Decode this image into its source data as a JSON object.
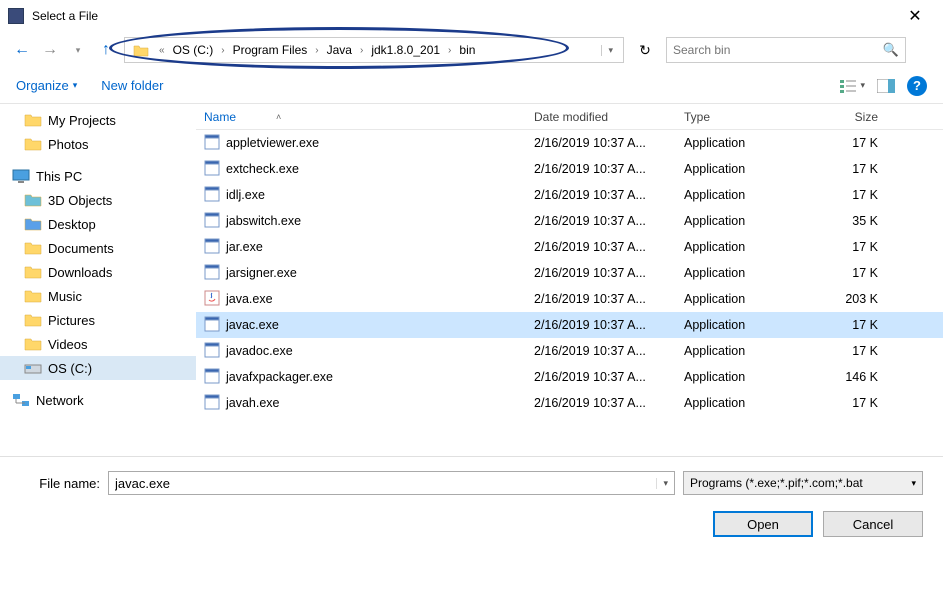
{
  "window": {
    "title": "Select a File"
  },
  "breadcrumb": {
    "parts": [
      "OS (C:)",
      "Program Files",
      "Java",
      "jdk1.8.0_201",
      "bin"
    ]
  },
  "search": {
    "placeholder": "Search bin"
  },
  "toolbar": {
    "organize": "Organize",
    "newfolder": "New folder"
  },
  "sidebar": {
    "quick": [
      {
        "label": "My Projects",
        "icon": "folder"
      },
      {
        "label": "Photos",
        "icon": "folder"
      }
    ],
    "thispc_label": "This PC",
    "thispc": [
      {
        "label": "3D Objects",
        "icon": "3d"
      },
      {
        "label": "Desktop",
        "icon": "desktop"
      },
      {
        "label": "Documents",
        "icon": "documents"
      },
      {
        "label": "Downloads",
        "icon": "downloads"
      },
      {
        "label": "Music",
        "icon": "music"
      },
      {
        "label": "Pictures",
        "icon": "pictures"
      },
      {
        "label": "Videos",
        "icon": "videos"
      },
      {
        "label": "OS (C:)",
        "icon": "drive",
        "selected": true
      }
    ],
    "network_label": "Network"
  },
  "columns": {
    "name": "Name",
    "date": "Date modified",
    "type": "Type",
    "size": "Size"
  },
  "files": [
    {
      "name": "appletviewer.exe",
      "date": "2/16/2019 10:37 A...",
      "type": "Application",
      "size": "17 K",
      "icon": "exe"
    },
    {
      "name": "extcheck.exe",
      "date": "2/16/2019 10:37 A...",
      "type": "Application",
      "size": "17 K",
      "icon": "exe"
    },
    {
      "name": "idlj.exe",
      "date": "2/16/2019 10:37 A...",
      "type": "Application",
      "size": "17 K",
      "icon": "exe"
    },
    {
      "name": "jabswitch.exe",
      "date": "2/16/2019 10:37 A...",
      "type": "Application",
      "size": "35 K",
      "icon": "exe"
    },
    {
      "name": "jar.exe",
      "date": "2/16/2019 10:37 A...",
      "type": "Application",
      "size": "17 K",
      "icon": "exe"
    },
    {
      "name": "jarsigner.exe",
      "date": "2/16/2019 10:37 A...",
      "type": "Application",
      "size": "17 K",
      "icon": "exe"
    },
    {
      "name": "java.exe",
      "date": "2/16/2019 10:37 A...",
      "type": "Application",
      "size": "203 K",
      "icon": "java"
    },
    {
      "name": "javac.exe",
      "date": "2/16/2019 10:37 A...",
      "type": "Application",
      "size": "17 K",
      "icon": "exe",
      "selected": true
    },
    {
      "name": "javadoc.exe",
      "date": "2/16/2019 10:37 A...",
      "type": "Application",
      "size": "17 K",
      "icon": "exe"
    },
    {
      "name": "javafxpackager.exe",
      "date": "2/16/2019 10:37 A...",
      "type": "Application",
      "size": "146 K",
      "icon": "exe"
    },
    {
      "name": "javah.exe",
      "date": "2/16/2019 10:37 A...",
      "type": "Application",
      "size": "17 K",
      "icon": "exe"
    }
  ],
  "footer": {
    "filename_label": "File name:",
    "filename_value": "javac.exe",
    "filter": "Programs (*.exe;*.pif;*.com;*.bat",
    "open": "Open",
    "cancel": "Cancel"
  }
}
